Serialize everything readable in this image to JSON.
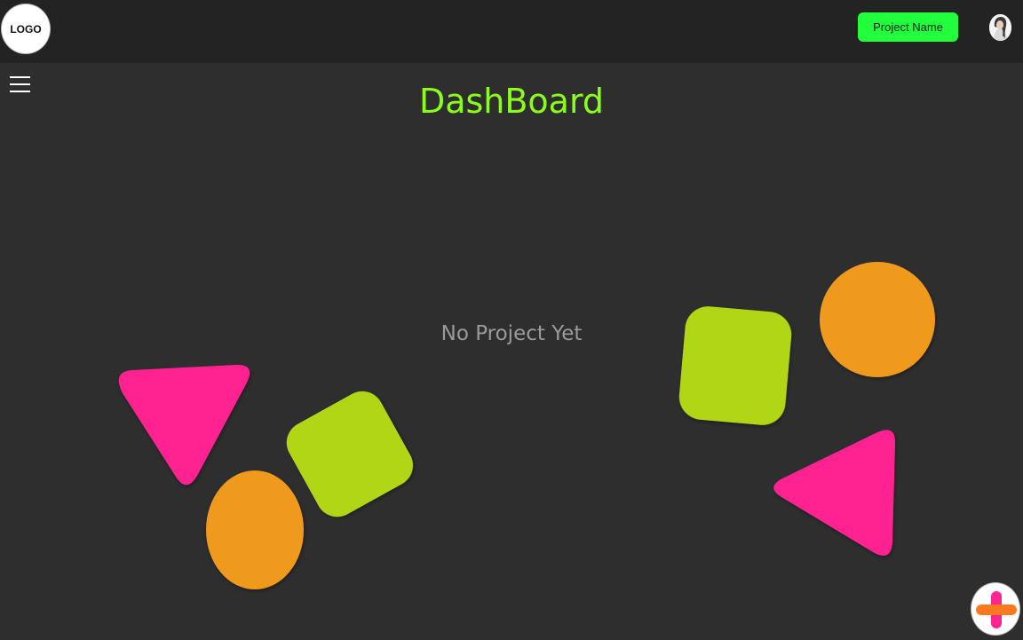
{
  "header": {
    "logo_text": "LOGO",
    "project_button_label": "Project Name"
  },
  "main": {
    "title": "DashBoard",
    "empty_state_text": "No Project Yet"
  },
  "colors": {
    "background": "#2e2e2e",
    "topbar": "#232323",
    "title_green": "#8bff1a",
    "button_green": "#22ff3c",
    "pink": "#ff2490",
    "lime": "#b0d616",
    "orange": "#ef9a1e"
  },
  "icons": {
    "menu": "hamburger-menu-icon",
    "avatar": "user-avatar",
    "fab": "plus-icon"
  }
}
